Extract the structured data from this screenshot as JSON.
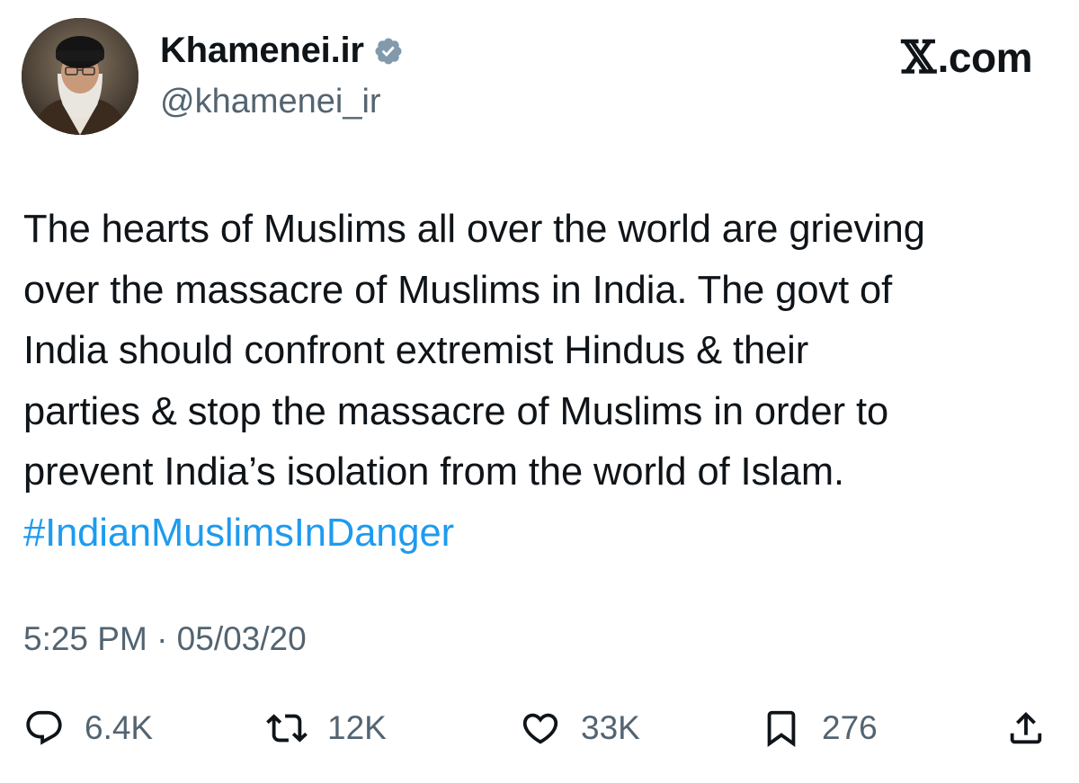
{
  "author": {
    "display_name": "Khamenei.ir",
    "handle": "@khamenei_ir",
    "verified": true
  },
  "brand": {
    "x_glyph": "𝕏",
    "suffix": ".com"
  },
  "tweet": {
    "lines": [
      "The hearts of Muslims all over the world are grieving",
      "over the massacre of Muslims in India. The govt of",
      "India should confront extremist Hindus & their",
      "parties & stop the massacre of Muslims in order to",
      "prevent India’s isolation from the world of Islam."
    ],
    "hashtag": "#IndianMuslimsInDanger"
  },
  "timestamp": "5:25 PM · 05/03/20",
  "metrics": {
    "replies": "6.4K",
    "reposts": "12K",
    "likes": "33K",
    "bookmarks": "276"
  },
  "colors": {
    "link": "#1d9bf0",
    "secondary_text": "#536471",
    "primary_text": "#0f1419"
  },
  "icons": [
    "verified-badge-icon",
    "reply-icon",
    "repost-icon",
    "like-icon",
    "bookmark-icon",
    "share-icon"
  ]
}
